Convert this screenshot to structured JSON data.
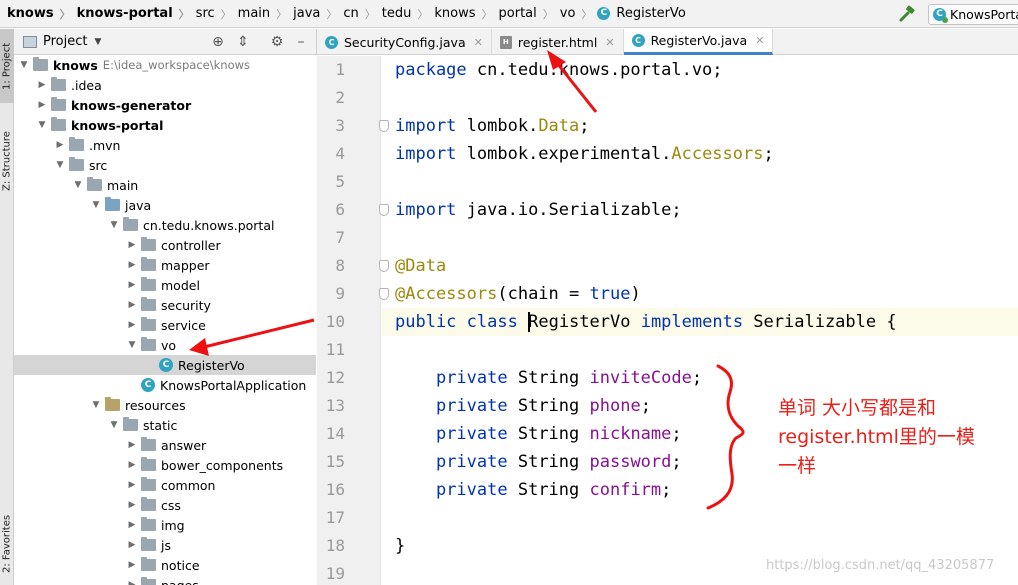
{
  "breadcrumb": [
    {
      "label": "knows",
      "bold": true
    },
    {
      "label": "knows-portal",
      "bold": true
    },
    {
      "label": "src"
    },
    {
      "label": "main"
    },
    {
      "label": "java"
    },
    {
      "label": "cn"
    },
    {
      "label": "tedu"
    },
    {
      "label": "knows"
    },
    {
      "label": "portal"
    },
    {
      "label": "vo"
    },
    {
      "label": "RegisterVo",
      "icon": "class-icon"
    }
  ],
  "run_config": {
    "label": "KnowsPorta"
  },
  "toolstrip": {
    "project": "1: Project",
    "structure": "Z: Structure",
    "favorites": "2: Favorites"
  },
  "project_panel": {
    "title": "Project"
  },
  "tree": [
    {
      "label": "knows",
      "path": "E:\\idea_workspace\\knows",
      "depth": 0,
      "expanded": true,
      "bold": true,
      "kind": "module"
    },
    {
      "label": ".idea",
      "depth": 1,
      "expanded": false,
      "kind": "folder"
    },
    {
      "label": "knows-generator",
      "depth": 1,
      "expanded": false,
      "bold": true,
      "kind": "module"
    },
    {
      "label": "knows-portal",
      "depth": 1,
      "expanded": true,
      "bold": true,
      "kind": "module"
    },
    {
      "label": ".mvn",
      "depth": 2,
      "expanded": false,
      "kind": "folder"
    },
    {
      "label": "src",
      "depth": 2,
      "expanded": true,
      "kind": "folder"
    },
    {
      "label": "main",
      "depth": 3,
      "expanded": true,
      "kind": "folder"
    },
    {
      "label": "java",
      "depth": 4,
      "expanded": true,
      "kind": "src"
    },
    {
      "label": "cn.tedu.knows.portal",
      "depth": 5,
      "expanded": true,
      "kind": "pkg"
    },
    {
      "label": "controller",
      "depth": 6,
      "expanded": false,
      "kind": "pkg"
    },
    {
      "label": "mapper",
      "depth": 6,
      "expanded": false,
      "kind": "pkg"
    },
    {
      "label": "model",
      "depth": 6,
      "expanded": false,
      "kind": "pkg"
    },
    {
      "label": "security",
      "depth": 6,
      "expanded": false,
      "kind": "pkg"
    },
    {
      "label": "service",
      "depth": 6,
      "expanded": false,
      "kind": "pkg"
    },
    {
      "label": "vo",
      "depth": 6,
      "expanded": true,
      "kind": "pkg"
    },
    {
      "label": "RegisterVo",
      "depth": 7,
      "kind": "class",
      "selected": true
    },
    {
      "label": "KnowsPortalApplication",
      "depth": 6,
      "kind": "class"
    },
    {
      "label": "resources",
      "depth": 4,
      "expanded": true,
      "kind": "res"
    },
    {
      "label": "static",
      "depth": 5,
      "expanded": true,
      "kind": "folder"
    },
    {
      "label": "answer",
      "depth": 6,
      "expanded": false,
      "kind": "folder"
    },
    {
      "label": "bower_components",
      "depth": 6,
      "expanded": false,
      "kind": "folder"
    },
    {
      "label": "common",
      "depth": 6,
      "expanded": false,
      "kind": "folder"
    },
    {
      "label": "css",
      "depth": 6,
      "expanded": false,
      "kind": "folder"
    },
    {
      "label": "img",
      "depth": 6,
      "expanded": false,
      "kind": "folder"
    },
    {
      "label": "js",
      "depth": 6,
      "expanded": false,
      "kind": "folder"
    },
    {
      "label": "notice",
      "depth": 6,
      "expanded": false,
      "kind": "folder"
    },
    {
      "label": "pages",
      "depth": 6,
      "expanded": false,
      "kind": "folder"
    }
  ],
  "tabs": [
    {
      "label": "SecurityConfig.java",
      "icon": "class-icon",
      "active": false
    },
    {
      "label": "register.html",
      "icon": "html-icon",
      "active": false
    },
    {
      "label": "RegisterVo.java",
      "icon": "class-icon",
      "active": true
    }
  ],
  "line_numbers": [
    "1",
    "2",
    "3",
    "4",
    "5",
    "6",
    "7",
    "8",
    "9",
    "10",
    "11",
    "12",
    "13",
    "14",
    "15",
    "16",
    "17",
    "18",
    "19"
  ],
  "code_lines": [
    [
      {
        "t": "package",
        "c": "kw"
      },
      {
        "t": " cn.tedu.knows.portal.vo;"
      }
    ],
    [],
    [
      {
        "t": "import",
        "c": "kw"
      },
      {
        "t": " lombok."
      },
      {
        "t": "Data",
        "c": "acc"
      },
      {
        "t": ";"
      }
    ],
    [
      {
        "t": "import",
        "c": "kw"
      },
      {
        "t": " lombok.experimental."
      },
      {
        "t": "Accessors",
        "c": "acc"
      },
      {
        "t": ";"
      }
    ],
    [],
    [
      {
        "t": "import",
        "c": "kw"
      },
      {
        "t": " java.io.Serializable;"
      }
    ],
    [],
    [
      {
        "t": "@Data",
        "c": "ann"
      }
    ],
    [
      {
        "t": "@Accessors",
        "c": "ann"
      },
      {
        "t": "(chain = "
      },
      {
        "t": "true",
        "c": "kw"
      },
      {
        "t": ")"
      }
    ],
    [
      {
        "t": "public",
        "c": "kw"
      },
      {
        "t": " "
      },
      {
        "t": "class",
        "c": "kw"
      },
      {
        "t": " "
      },
      {
        "t": "|cursor|"
      },
      {
        "t": "RegisterVo "
      },
      {
        "t": "implements",
        "c": "kw"
      },
      {
        "t": " Serializable {"
      }
    ],
    [],
    [
      {
        "t": "    "
      },
      {
        "t": "private",
        "c": "kw"
      },
      {
        "t": " String "
      },
      {
        "t": "inviteCode",
        "c": "fld"
      },
      {
        "t": ";"
      }
    ],
    [
      {
        "t": "    "
      },
      {
        "t": "private",
        "c": "kw"
      },
      {
        "t": " String "
      },
      {
        "t": "phone",
        "c": "fld"
      },
      {
        "t": ";"
      }
    ],
    [
      {
        "t": "    "
      },
      {
        "t": "private",
        "c": "kw"
      },
      {
        "t": " String "
      },
      {
        "t": "nickname",
        "c": "fld"
      },
      {
        "t": ";"
      }
    ],
    [
      {
        "t": "    "
      },
      {
        "t": "private",
        "c": "kw"
      },
      {
        "t": " String "
      },
      {
        "t": "password",
        "c": "fld"
      },
      {
        "t": ";"
      }
    ],
    [
      {
        "t": "    "
      },
      {
        "t": "private",
        "c": "kw"
      },
      {
        "t": " String "
      },
      {
        "t": "confirm",
        "c": "fld"
      },
      {
        "t": ";"
      }
    ],
    [],
    [
      {
        "t": "}"
      }
    ],
    []
  ],
  "current_line": "10",
  "annotation_note": {
    "line1": "单词 大小写都是和",
    "line2": "register.html里的一模",
    "line3": "一样"
  },
  "watermark": "https://blog.csdn.net/qq_43205877",
  "colors": {
    "keyword": "#0033b3",
    "annotation": "#9e880d",
    "field": "#871094",
    "note_red": "#e8211a",
    "class_icon": "#30a3c2"
  }
}
